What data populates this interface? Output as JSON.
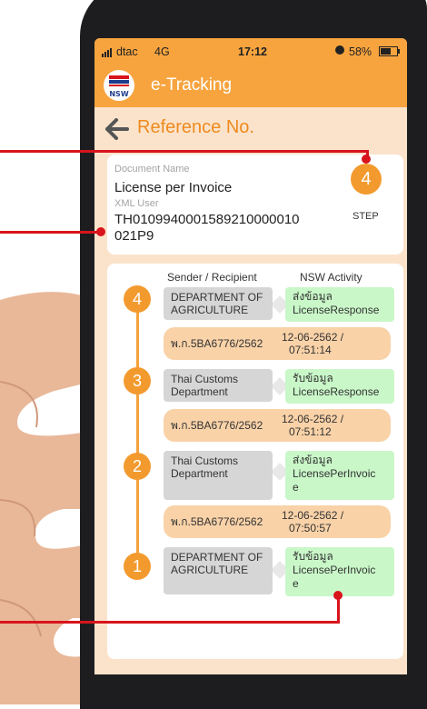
{
  "status_bar": {
    "carrier": "dtac",
    "network": "4G",
    "time": "17:12",
    "battery": "58%"
  },
  "app_bar": {
    "logo_text": "NSW",
    "title": "e-Tracking"
  },
  "sub_header": {
    "title": "Reference No."
  },
  "document": {
    "name_label": "Document Name",
    "name_value": "License per Invoice",
    "xml_user_label": "XML User",
    "xml_user_value_line1": "TH0109940001589210000010",
    "xml_user_value_line2": "021P9",
    "step_number": "4",
    "step_label": "STEP"
  },
  "tracking": {
    "col_sender": "Sender / Recipient",
    "col_activity": "NSW Activity",
    "steps": [
      {
        "number": "4",
        "sender_line1": "DEPARTMENT OF",
        "sender_line2": "AGRICULTURE",
        "activity_line1": "ส่งข้อมูล",
        "activity_line2": "LicenseResponse",
        "activity_line3": "",
        "ref": "พ.ก.5BA6776/2562",
        "date": "12-06-2562 /",
        "time": "07:51:14"
      },
      {
        "number": "3",
        "sender_line1": "Thai Customs",
        "sender_line2": "Department",
        "activity_line1": "รับข้อมูล",
        "activity_line2": "LicenseResponse",
        "activity_line3": "",
        "ref": "พ.ก.5BA6776/2562",
        "date": "12-06-2562 /",
        "time": "07:51:12"
      },
      {
        "number": "2",
        "sender_line1": "Thai Customs",
        "sender_line2": "Department",
        "activity_line1": "ส่งข้อมูล",
        "activity_line2": "LicensePerInvoic",
        "activity_line3": "e",
        "ref": "พ.ก.5BA6776/2562",
        "date": "12-06-2562 /",
        "time": "07:50:57"
      },
      {
        "number": "1",
        "sender_line1": "DEPARTMENT OF",
        "sender_line2": "AGRICULTURE",
        "activity_line1": "รับข้อมูล",
        "activity_line2": "LicensePerInvoic",
        "activity_line3": "e"
      }
    ]
  },
  "colors": {
    "accent": "#f7a43f",
    "screen_bg": "#fbe3cb",
    "activity_bg": "#c9f7c8",
    "sender_bg": "#d6d6d6",
    "ref_bg": "#f9d2a8",
    "annotation": "#d8141c"
  }
}
